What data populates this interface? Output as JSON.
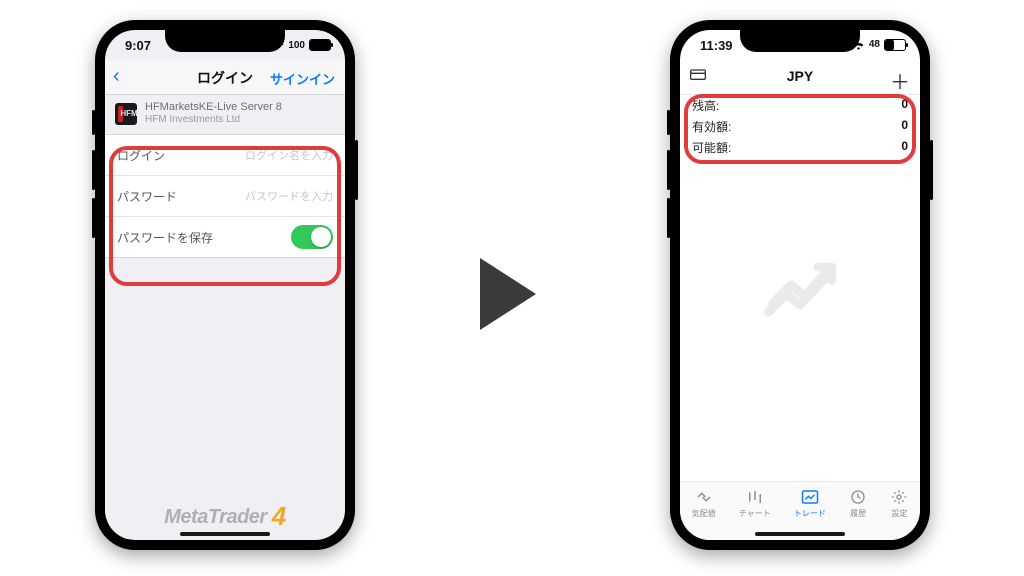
{
  "left": {
    "status": {
      "time": "9:07",
      "battery": "100"
    },
    "nav": {
      "title": "ログイン",
      "action": "サインイン"
    },
    "server": {
      "line1": "HFMarketsKE-Live Server 8",
      "line2": "HFM Investments Ltd",
      "logo_text": "HFM"
    },
    "form": {
      "login_label": "ログイン",
      "login_placeholder": "ログイン名を入力",
      "password_label": "パスワード",
      "password_placeholder": "パスワードを入力",
      "save_label": "パスワードを保存"
    },
    "brand": {
      "name": "MetaTrader",
      "num": "4"
    }
  },
  "right": {
    "status": {
      "time": "11:39",
      "battery": "48"
    },
    "nav": {
      "title": "JPY"
    },
    "balance": {
      "rows": [
        {
          "k": "残高:",
          "v": "0"
        },
        {
          "k": "有効額:",
          "v": "0"
        },
        {
          "k": "可能額:",
          "v": "0"
        }
      ]
    },
    "tabs": [
      {
        "label": "気配値"
      },
      {
        "label": "チャート"
      },
      {
        "label": "トレード"
      },
      {
        "label": "履歴"
      },
      {
        "label": "設定"
      }
    ],
    "active_tab": 2
  }
}
